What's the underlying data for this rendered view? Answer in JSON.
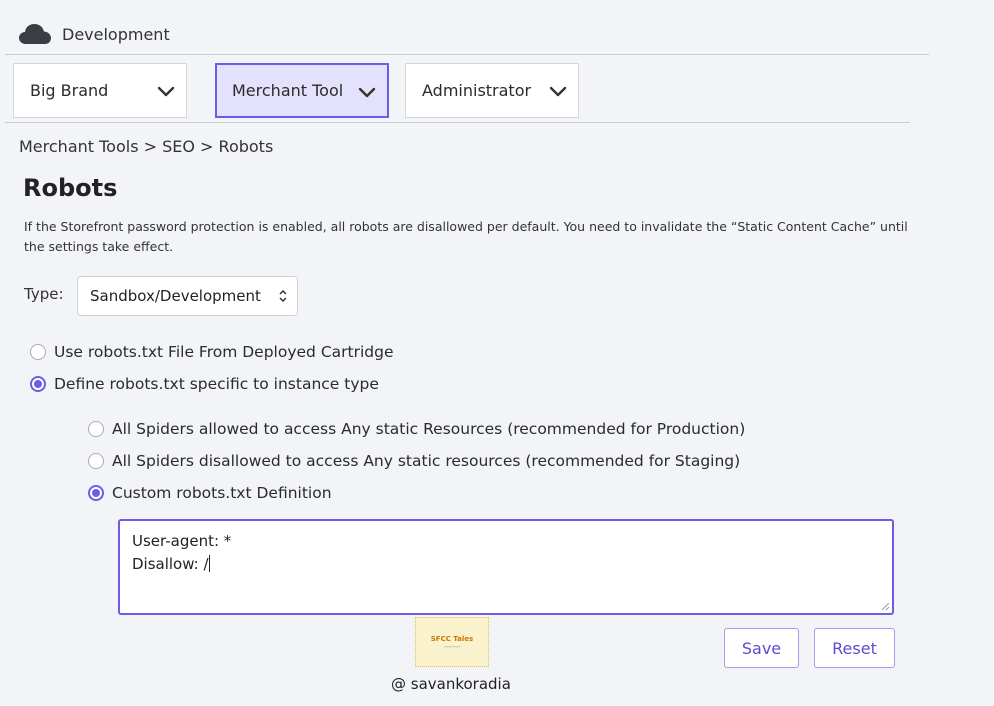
{
  "header": {
    "env_icon": "cloud-icon",
    "env_label": "Development",
    "dropdowns": [
      {
        "label": "Big Brand",
        "icon": "chevron-down-icon"
      },
      {
        "label": "Merchant Tool",
        "icon": "chevron-down-icon"
      },
      {
        "label": "Administrator",
        "icon": "chevron-down-icon"
      }
    ]
  },
  "breadcrumb": "Merchant Tools > SEO > Robots",
  "page": {
    "title": "Robots",
    "description": "If the Storefront password protection is enabled, all robots are disallowed per default. You need to invalidate the “Static Content Cache” until the settings take effect.",
    "type_label": "Type:",
    "type_value": "Sandbox/Development"
  },
  "source_options": [
    {
      "label": "Use robots.txt File From Deployed Cartridge",
      "selected": false
    },
    {
      "label": "Define robots.txt specific to instance type",
      "selected": true
    }
  ],
  "instance_options": [
    {
      "label": "All Spiders  allowed to access Any static Resources (recommended for Production)",
      "selected": false
    },
    {
      "label": "All Spiders disallowed to access Any static resources (recommended for Staging)",
      "selected": false
    },
    {
      "label": "Custom robots.txt Definition",
      "selected": true
    }
  ],
  "custom_definition": {
    "line1": "User-agent: *",
    "line2": "Disallow: /"
  },
  "buttons": {
    "save": "Save",
    "reset": "Reset"
  },
  "watermark": {
    "logo_text": "SFCC Tales",
    "credit": "@ savankoradia"
  },
  "colors": {
    "accent": "#6f5ce6",
    "active_tab_bg": "#e3e1fb",
    "background": "#f2f4f7"
  }
}
